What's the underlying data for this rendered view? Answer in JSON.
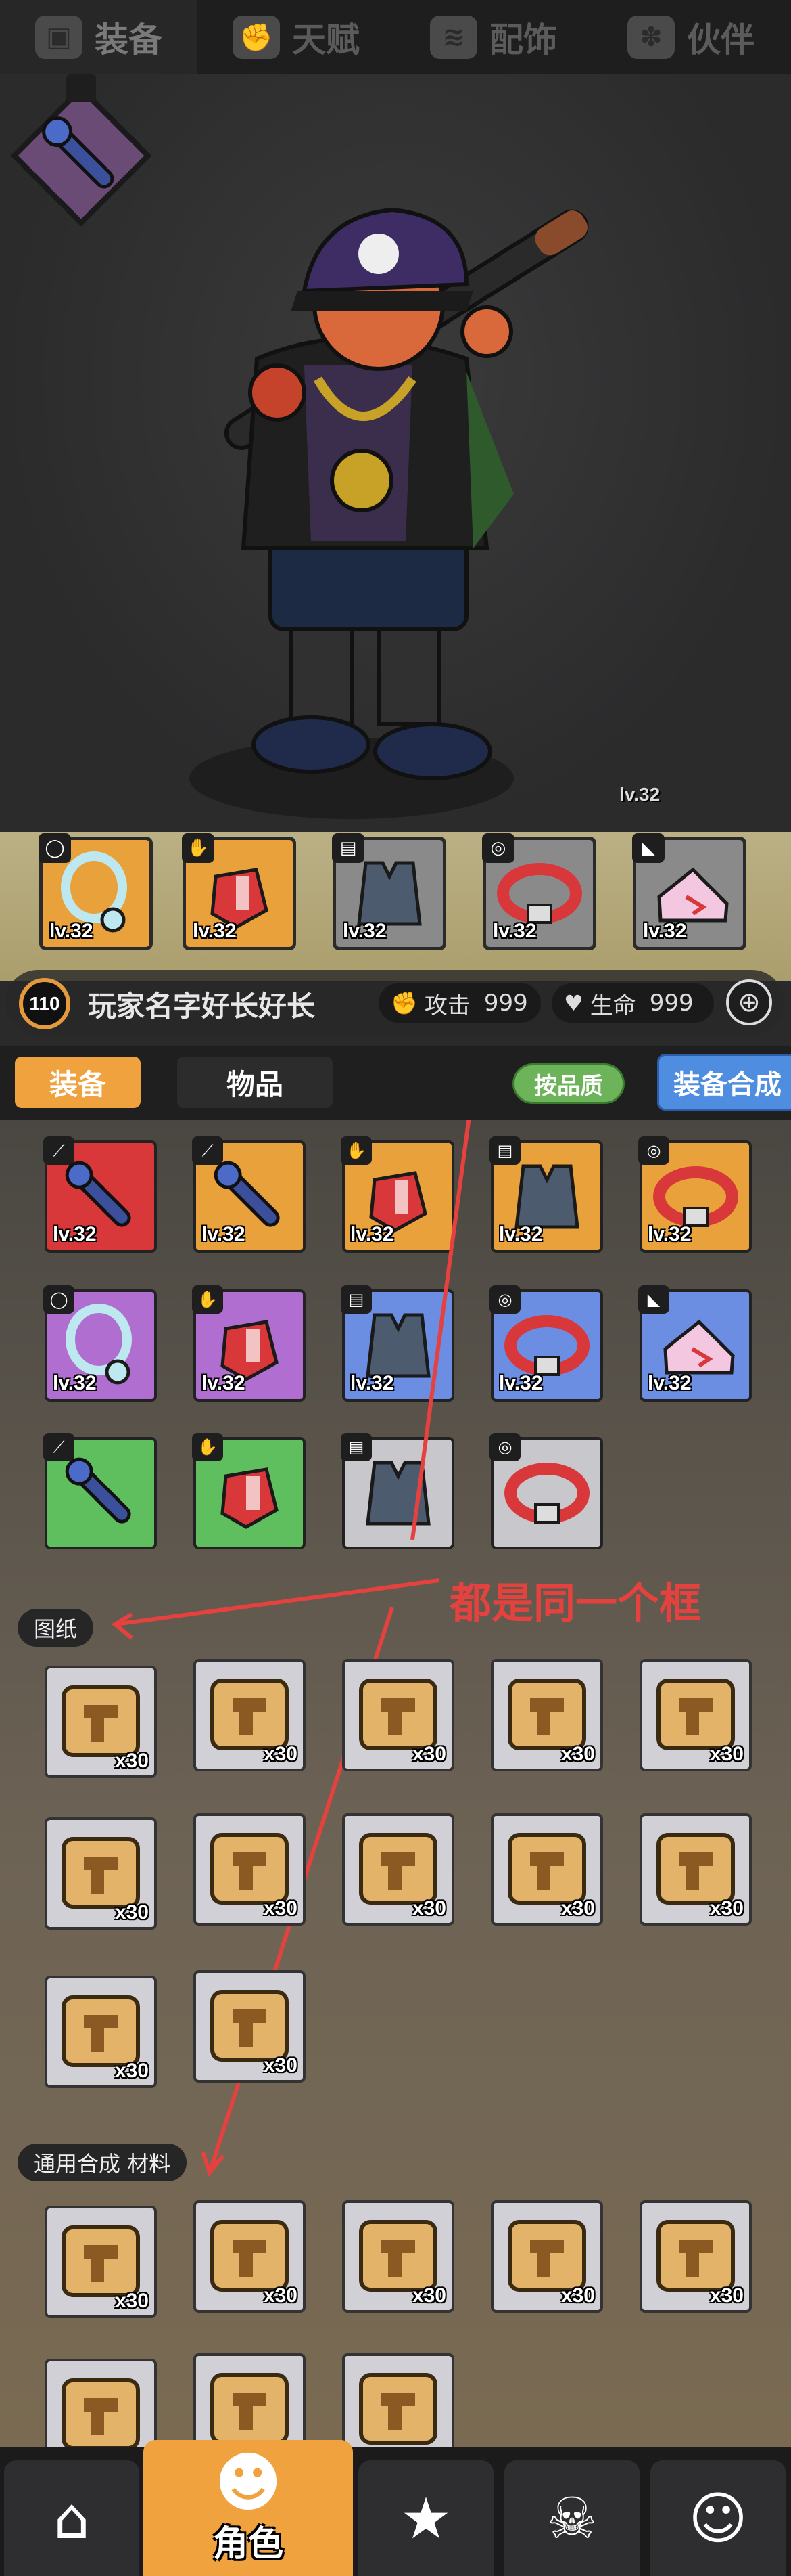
{
  "top_tabs": [
    {
      "label": "装备",
      "icon": "backpack-icon",
      "active": true
    },
    {
      "label": "天赋",
      "icon": "muscle-icon",
      "active": false
    },
    {
      "label": "配饰",
      "icon": "layers-icon",
      "active": false
    },
    {
      "label": "伙伴",
      "icon": "paw-icon",
      "active": false
    }
  ],
  "weapon_preview": {
    "level": "lv.32",
    "icon": "bat-icon"
  },
  "equipped": [
    {
      "level": "lv.32",
      "category": "necklace-icon",
      "item": "necklace"
    },
    {
      "level": "lv.32",
      "category": "glove-icon",
      "item": "glove"
    },
    {
      "level": "lv.32",
      "category": "armor-icon",
      "item": "vest"
    },
    {
      "level": "lv.32",
      "category": "belt-icon",
      "item": "belt"
    },
    {
      "level": "lv.32",
      "category": "shoe-icon",
      "item": "shoe"
    }
  ],
  "player": {
    "level": "110",
    "name": "玩家名字好长好长",
    "attack_label": "攻击",
    "attack_value": "999",
    "hp_label": "生命",
    "hp_value": "999"
  },
  "inventory_tabs": {
    "equipment": "装备",
    "items": "物品",
    "sort_button": "按品质",
    "craft_button": "装备合成"
  },
  "equipment_items": [
    {
      "color": "#d8383a",
      "item": "bat",
      "level": "lv.32"
    },
    {
      "color": "#e9a13b",
      "item": "bat",
      "level": "lv.32"
    },
    {
      "color": "#e9a13b",
      "item": "glove",
      "level": "lv.32"
    },
    {
      "color": "#e9a13b",
      "item": "vest",
      "level": "lv.32"
    },
    {
      "color": "#e9a13b",
      "item": "belt",
      "level": "lv.32"
    },
    {
      "color": "#b06fd0",
      "item": "necklace",
      "level": "lv.32"
    },
    {
      "color": "#b06fd0",
      "item": "glove",
      "level": "lv.32"
    },
    {
      "color": "#6b8ee2",
      "item": "vest",
      "level": "lv.32"
    },
    {
      "color": "#6b8ee2",
      "item": "belt",
      "level": "lv.32"
    },
    {
      "color": "#6b8ee2",
      "item": "shoe",
      "level": "lv.32"
    },
    {
      "color": "#5fbf5e",
      "item": "bat",
      "level": ""
    },
    {
      "color": "#5fbf5e",
      "item": "glove",
      "level": ""
    },
    {
      "color": "#c7c7cc",
      "item": "vest",
      "level": ""
    },
    {
      "color": "#c7c7cc",
      "item": "belt",
      "level": ""
    }
  ],
  "sections": {
    "blueprints": "图纸",
    "materials": "通用合成 材料"
  },
  "blueprint_qty": "x30",
  "annotation": "都是同一个框",
  "bottom_nav": [
    {
      "icon": "shop-icon"
    },
    {
      "icon": "monkey-icon",
      "label": "角色",
      "active": true
    },
    {
      "icon": "star-icon"
    },
    {
      "icon": "skull-icon"
    },
    {
      "icon": "friends-icon"
    }
  ]
}
